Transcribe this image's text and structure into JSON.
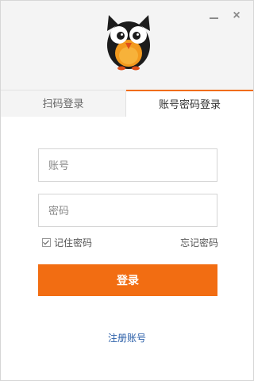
{
  "window": {
    "minimize_icon": "minimize-icon",
    "close_label": "×"
  },
  "logo": {
    "icon": "owl-logo"
  },
  "tabs": [
    {
      "label": "扫码登录",
      "active": false
    },
    {
      "label": "账号密码登录",
      "active": true
    }
  ],
  "form": {
    "username_placeholder": "账号",
    "username_value": "",
    "password_placeholder": "密码",
    "password_value": "",
    "remember_label": "记住密码",
    "remember_checked": true,
    "forgot_label": "忘记密码",
    "login_label": "登录",
    "register_label": "注册账号"
  },
  "colors": {
    "accent": "#f26d12",
    "link": "#2a5ea8",
    "header_bg": "#f4f4f4"
  }
}
